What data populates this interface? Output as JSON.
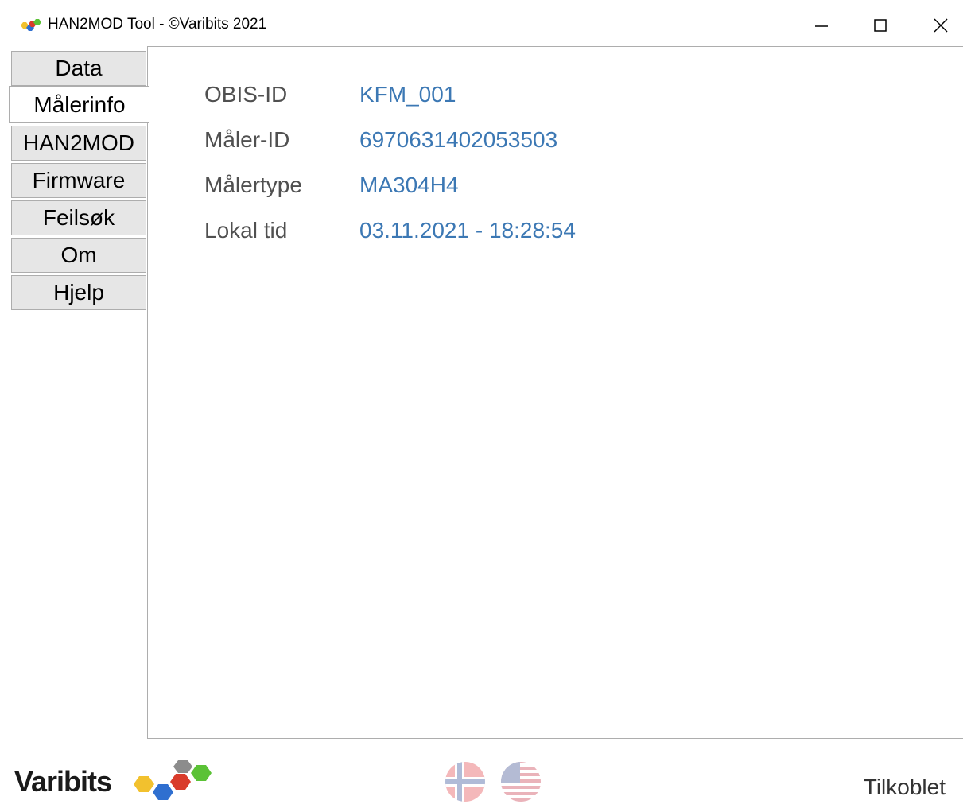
{
  "window": {
    "title": "HAN2MOD Tool - ©Varibits 2021",
    "controls": {
      "minimize_icon": "minimize-icon",
      "maximize_icon": "maximize-icon",
      "close_icon": "close-icon"
    }
  },
  "tabs": [
    {
      "label": "Data",
      "selected": false
    },
    {
      "label": "Målerinfo",
      "selected": true
    },
    {
      "label": "HAN2MOD",
      "selected": false
    },
    {
      "label": "Firmware",
      "selected": false
    },
    {
      "label": "Feilsøk",
      "selected": false
    },
    {
      "label": "Om",
      "selected": false
    },
    {
      "label": "Hjelp",
      "selected": false
    }
  ],
  "meter_info": {
    "rows": [
      {
        "label": "OBIS-ID",
        "value": "KFM_001"
      },
      {
        "label": "Måler-ID",
        "value": "6970631402053503"
      },
      {
        "label": "Målertype",
        "value": "MA304H4"
      },
      {
        "label": "Lokal tid",
        "value": "03.11.2021 - 18:28:54"
      }
    ]
  },
  "footer": {
    "brand": "Varibits",
    "languages": [
      {
        "icon": "norway-flag-icon"
      },
      {
        "icon": "usa-flag-icon"
      }
    ],
    "status": "Tilkoblet"
  },
  "colors": {
    "value_text": "#3c78b4",
    "label_text": "#505050",
    "tab_bg": "#e6e6e6",
    "tab_border": "#adadad"
  }
}
